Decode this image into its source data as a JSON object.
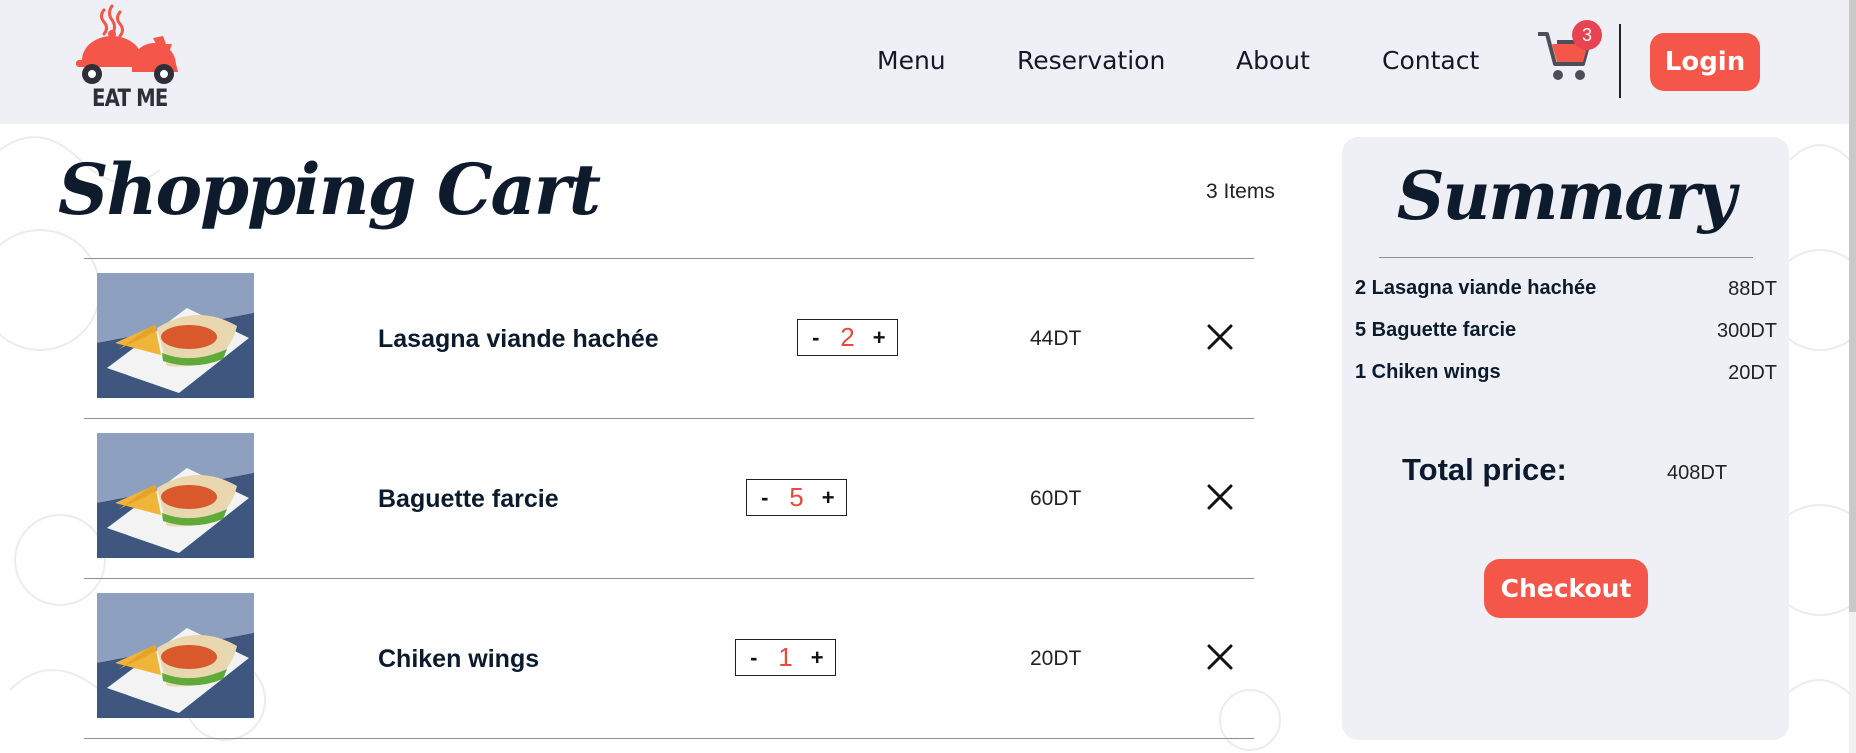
{
  "brand": {
    "name": "EAT ME"
  },
  "nav": {
    "links": [
      "Menu",
      "Reservation",
      "About",
      "Contact"
    ],
    "cart_count": "3",
    "login_label": "Login"
  },
  "cart": {
    "title": "Shopping Cart",
    "count_label": "3 Items",
    "items": [
      {
        "name": "Lasagna viande hachée",
        "qty": "2",
        "price": "44DT"
      },
      {
        "name": "Baguette farcie",
        "qty": "5",
        "price": "60DT"
      },
      {
        "name": "Chiken wings",
        "qty": "1",
        "price": "20DT"
      }
    ],
    "minus": "-",
    "plus": "+"
  },
  "summary": {
    "title": "Summary",
    "lines": [
      {
        "label": "2 Lasagna viande hachée",
        "price": "88DT"
      },
      {
        "label": "5 Baguette farcie",
        "price": "300DT"
      },
      {
        "label": "1 Chiken wings",
        "price": "20DT"
      }
    ],
    "total_label": "Total price:",
    "total_value": "408DT",
    "checkout_label": "Checkout"
  },
  "colors": {
    "accent": "#f5564a",
    "badge": "#e74353",
    "header_bg": "#eff0f5",
    "text_dark": "#0b1a2c"
  },
  "icons": [
    "food-delivery-scooter-logo-icon",
    "shopping-cart-icon",
    "close-icon",
    "minus-icon",
    "plus-icon"
  ]
}
